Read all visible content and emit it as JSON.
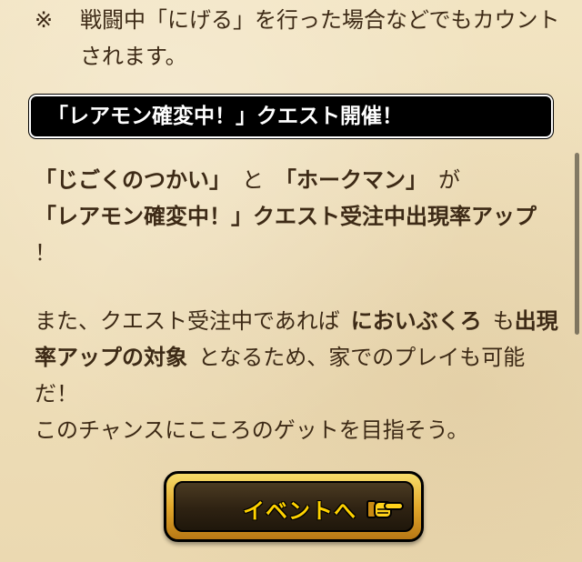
{
  "note": {
    "mark": "※",
    "text": "戦闘中「にげる」を行った場合などでもカウントされます。"
  },
  "section": {
    "title": "「レアモン確変中！」クエスト開催！"
  },
  "paragraph1": {
    "monster1": "「じごくのつかい」",
    "and": "と",
    "monster2": "「ホークマン」",
    "ga": "が",
    "quest": "「レアモン確変中！」クエスト受注中出現率アップ",
    "end": "！"
  },
  "paragraph2": {
    "t1": "また、クエスト受注中であれば",
    "item": "においぶくろ",
    "t2": "も",
    "target": "出現率アップの対象",
    "t3": "となるため、家でのプレイも可能だ！",
    "line2": "このチャンスにこころのゲットを目指そう。"
  },
  "event_button": {
    "label": "イベントへ",
    "icon": "pointing-hand-icon"
  },
  "colors": {
    "background": "#efdfba",
    "text": "#3d2a16",
    "title_bg": "#000000",
    "title_text": "#ffffff",
    "button_gold": "#e2a82b",
    "button_label": "#ffd200"
  }
}
